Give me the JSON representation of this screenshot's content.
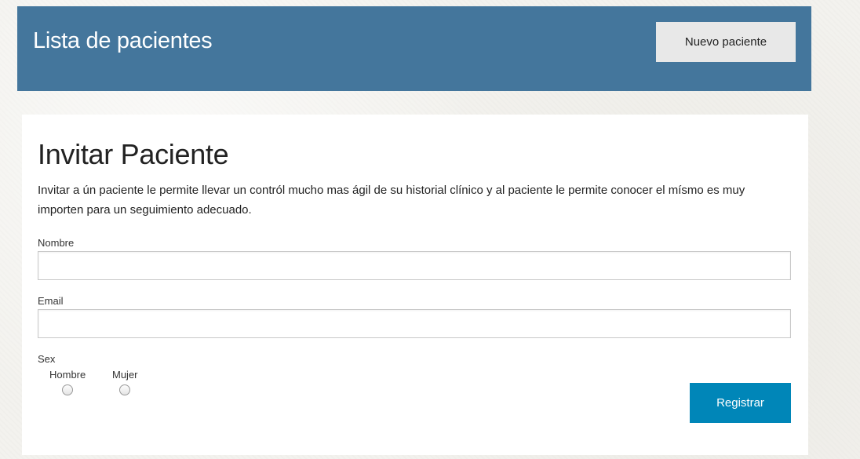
{
  "header": {
    "title": "Lista de pacientes",
    "new_patient_label": "Nuevo paciente"
  },
  "invite": {
    "title": "Invitar Paciente",
    "description": "Invitar a ún paciente le permite llevar un contról mucho mas ágil de su historial clínico y al paciente le permite conocer el mísmo es muy importen para un seguimiento adecuado.",
    "name_label": "Nombre",
    "name_value": "",
    "email_label": "Email",
    "email_value": "",
    "sex_label": "Sex",
    "sex_options": [
      {
        "label": "Hombre",
        "selected": false
      },
      {
        "label": "Mujer",
        "selected": false
      }
    ],
    "submit_label": "Registrar"
  },
  "colors": {
    "header_bg": "#44769c",
    "submit_bg": "#0086b8",
    "secondary_button_bg": "#e8e8e8",
    "page_bg": "#f3f2ee"
  }
}
